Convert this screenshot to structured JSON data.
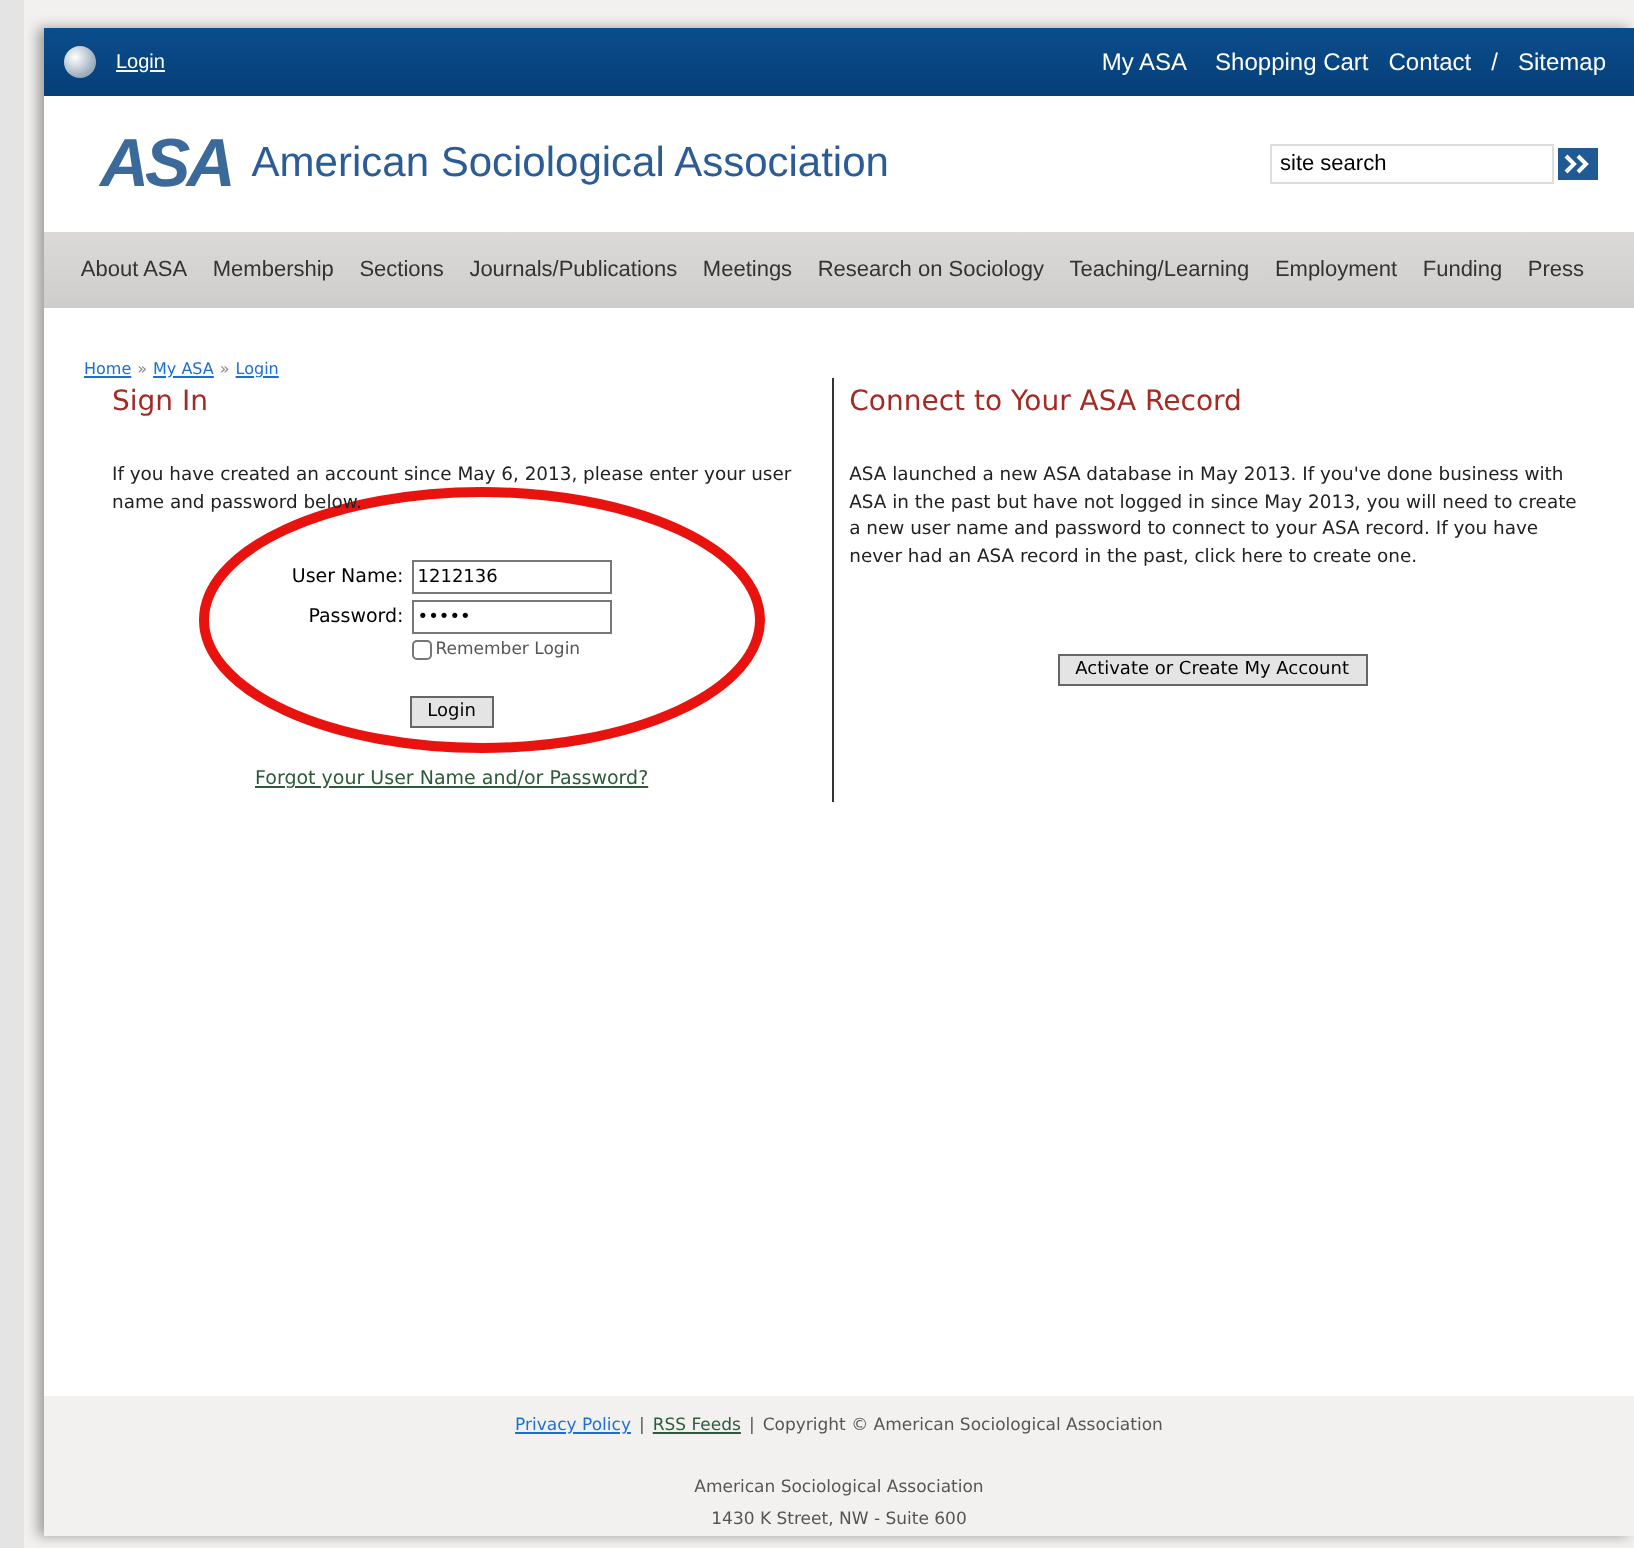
{
  "topbar": {
    "login_link": "Login",
    "links": [
      "My ASA",
      "Shopping Cart",
      "Contact",
      "/",
      "Sitemap"
    ]
  },
  "header": {
    "logo_text": "ASA",
    "site_name": "American Sociological Association",
    "search": {
      "value": "site search"
    }
  },
  "nav": [
    "About ASA",
    "Membership",
    "Sections",
    "Journals/Publications",
    "Meetings",
    "Research on Sociology",
    "Teaching/Learning",
    "Employment",
    "Funding",
    "Press"
  ],
  "breadcrumb": [
    "Home",
    "»",
    "My ASA",
    "»",
    "Login"
  ],
  "sign_in": {
    "title": "Sign In",
    "intro": "If you have created an account since May 6, 2013, please enter your user name and password below.",
    "username_label": "User Name:",
    "username_value": "1212136",
    "password_label": "Password:",
    "password_value": "•••••",
    "remember": {
      "label": "Remember Login",
      "checked": false
    },
    "button": "Login",
    "forgot": "Forgot your User Name and/or Password?"
  },
  "connect": {
    "title": "Connect to Your ASA Record",
    "text": "ASA launched a new ASA database in May 2013. If you've done business with ASA in the past but have not logged in since May 2013, you will need to create a new user name and password to connect to your ASA record. If you have never had an ASA record in the past, click here to create one.",
    "button": "Activate or Create My Account"
  },
  "footer": {
    "links": [
      "Privacy Policy",
      "|",
      "RSS Feeds",
      "|",
      "Copyright © American Sociological Association"
    ],
    "address": [
      "American Sociological Association",
      "1430 K Street, NW - Suite 600"
    ]
  }
}
